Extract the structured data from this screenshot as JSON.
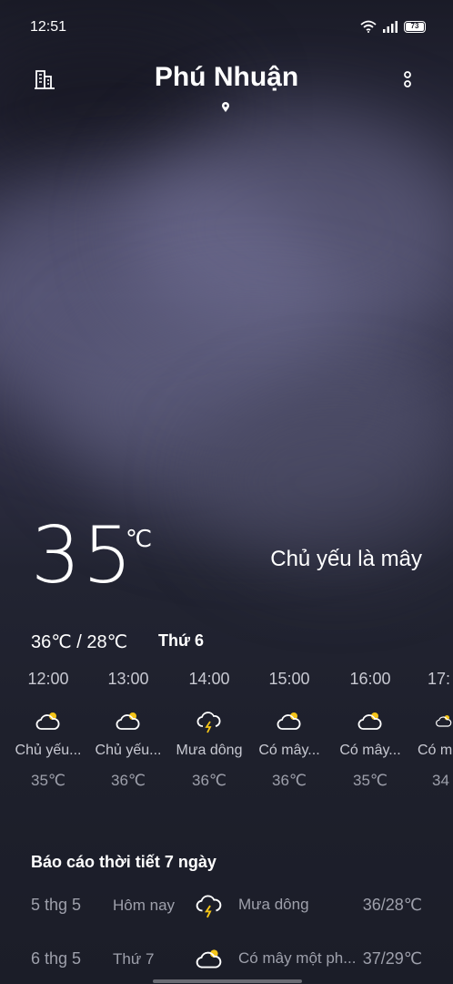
{
  "status_bar": {
    "time": "12:51",
    "battery": "73"
  },
  "header": {
    "city": "Phú Nhuận"
  },
  "current": {
    "temperature": "35",
    "unit": "℃",
    "condition": "Chủ yếu là mây",
    "range": "36℃ / 28℃",
    "day": "Thứ 6"
  },
  "hourly": [
    {
      "time": "12:00",
      "icon": "partly-cloudy-icon",
      "desc": "Chủ yếu...",
      "temp": "35℃"
    },
    {
      "time": "13:00",
      "icon": "partly-cloudy-icon",
      "desc": "Chủ yếu...",
      "temp": "36℃"
    },
    {
      "time": "14:00",
      "icon": "thunderstorm-icon",
      "desc": "Mưa dông",
      "temp": "36℃"
    },
    {
      "time": "15:00",
      "icon": "partly-cloudy-icon",
      "desc": "Có mây...",
      "temp": "36℃"
    },
    {
      "time": "16:00",
      "icon": "partly-cloudy-icon",
      "desc": "Có mây...",
      "temp": "35℃"
    },
    {
      "time": "17:",
      "icon": "partly-cloudy-icon",
      "desc": "Có m",
      "temp": "34"
    }
  ],
  "forecast": {
    "title": "Báo cáo thời tiết 7 ngày",
    "rows": [
      {
        "date": "5 thg 5",
        "day": "Hôm nay",
        "icon": "thunderstorm-icon",
        "desc": "Mưa dông",
        "temp": "36/28℃"
      },
      {
        "date": "6 thg 5",
        "day": "Thứ 7",
        "icon": "partly-cloudy-icon",
        "desc": "Có mây một ph...",
        "temp": "37/29℃"
      }
    ]
  },
  "colors": {
    "sun_accent": "#f5c518",
    "text_muted": "#9ea0ab"
  }
}
